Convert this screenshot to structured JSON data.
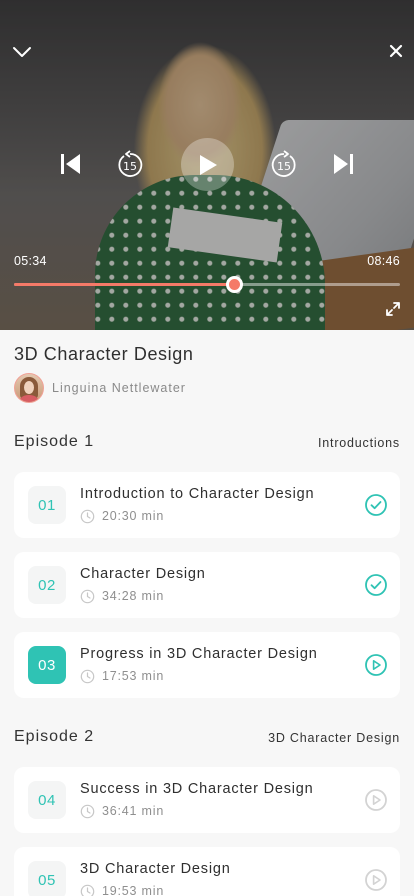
{
  "player": {
    "current_time": "05:34",
    "duration": "08:46",
    "progress": 0.57,
    "skip_back_label": "15",
    "skip_forward_label": "15"
  },
  "course": {
    "title": "3D Character Design",
    "author": "Linguina Nettlewater"
  },
  "episodes": [
    {
      "heading": "Episode 1",
      "subtitle": "Introductions",
      "lessons": [
        {
          "number": "01",
          "title": "Introduction to Character Design",
          "duration": "20:30 min",
          "status": "completed"
        },
        {
          "number": "02",
          "title": "Character Design",
          "duration": "34:28 min",
          "status": "completed"
        },
        {
          "number": "03",
          "title": "Progress in 3D Character Design",
          "duration": "17:53 min",
          "status": "playing"
        }
      ]
    },
    {
      "heading": "Episode 2",
      "subtitle": "3D Character Design",
      "lessons": [
        {
          "number": "04",
          "title": "Success in 3D Character Design",
          "duration": "36:41 min",
          "status": "locked"
        },
        {
          "number": "05",
          "title": "3D Character Design",
          "duration": "19:53 min",
          "status": "locked"
        }
      ]
    }
  ],
  "colors": {
    "accent": "#2fc3b4",
    "progress": "#f57a68",
    "inactive_icon": "#d3d3d3"
  },
  "icons": {
    "collapse": "chevron-down-icon",
    "close": "close-icon",
    "previous": "skip-previous-icon",
    "rewind": "rewind-15-icon",
    "play": "play-icon",
    "forward": "forward-15-icon",
    "next": "skip-next-icon",
    "fullscreen": "expand-icon",
    "duration": "clock-icon",
    "completed": "check-circle-icon",
    "playing": "play-circle-icon",
    "locked": "play-circle-outline-icon"
  }
}
